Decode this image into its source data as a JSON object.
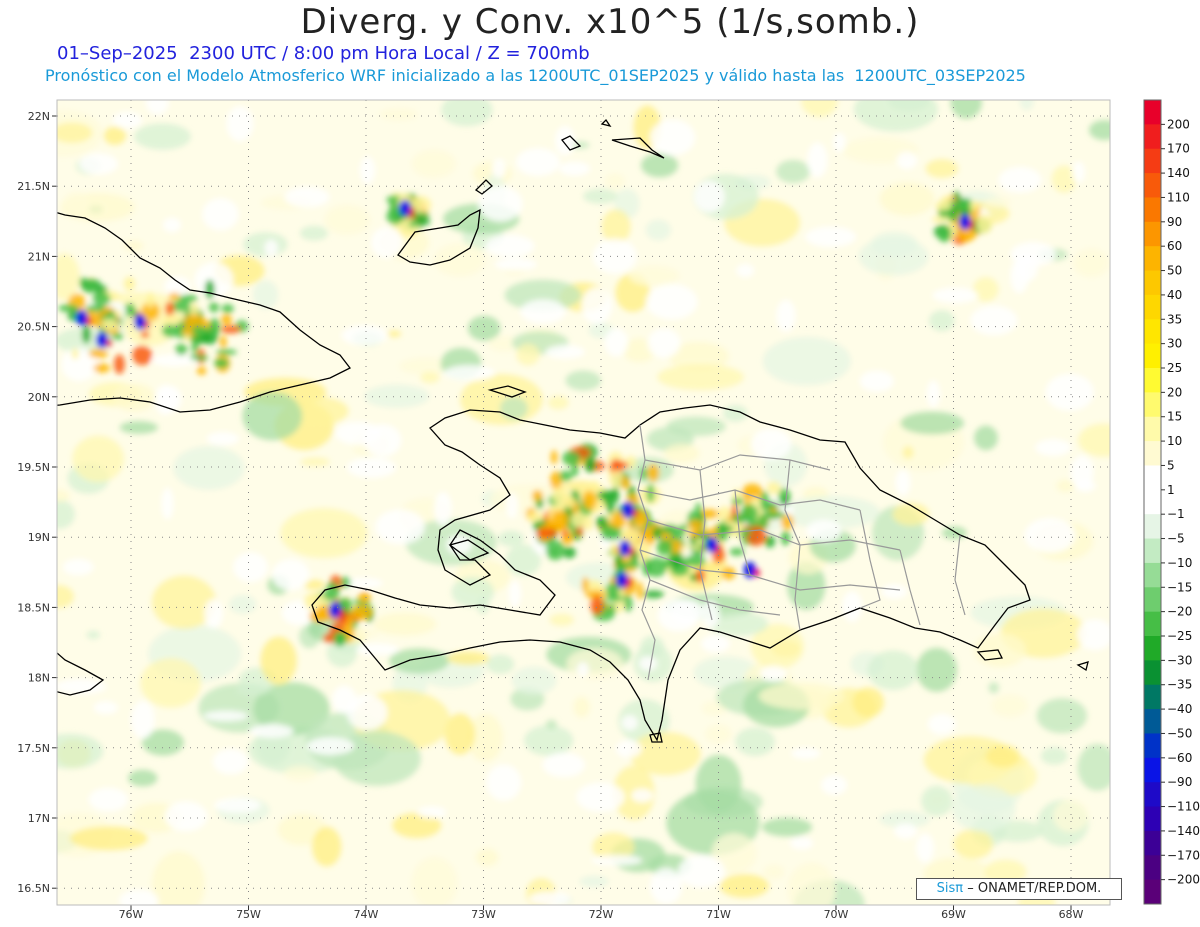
{
  "title": "Diverg. y Conv. x10^5 (1/s,somb.)",
  "subtitle_time": "01–Sep–2025  2300 UTC / 8:00 pm Hora Local / Z = 700mb",
  "subtitle_model": "Pronóstico con el Modelo Atmosferico WRF inicializado a las 1200UTC_01SEP2025 y válido hasta las  1200UTC_03SEP2025",
  "credit": {
    "brand": "Sisπ",
    "rest": "– ONAMET/REP.DOM."
  },
  "lat_labels": [
    "22N",
    "21.5N",
    "21N",
    "20.5N",
    "20N",
    "19.5N",
    "19N",
    "18.5N",
    "18N",
    "17.5N",
    "17N",
    "16.5N"
  ],
  "lon_labels": [
    "76W",
    "75W",
    "74W",
    "73W",
    "72W",
    "71W",
    "70W",
    "69W",
    "68W"
  ],
  "colorbar": {
    "labels": [
      "200",
      "170",
      "140",
      "110",
      "90",
      "60",
      "50",
      "40",
      "35",
      "30",
      "25",
      "20",
      "15",
      "10",
      "5",
      "1",
      "−1",
      "−5",
      "−10",
      "−15",
      "−20",
      "−25",
      "−30",
      "−35",
      "−40",
      "−50",
      "−60",
      "−90",
      "−110",
      "−140",
      "−170",
      "−200"
    ],
    "colors": [
      "#e8002a",
      "#f01e1e",
      "#f53c14",
      "#f85a0a",
      "#fa7800",
      "#fc9600",
      "#fdb400",
      "#fdc800",
      "#fed700",
      "#ffe600",
      "#fff000",
      "#fffa32",
      "#fffa6e",
      "#fffaaa",
      "#fffad2",
      "#ffffff",
      "#ffffff",
      "#e6f5e6",
      "#c3ebc3",
      "#96dc96",
      "#6ecd6e",
      "#46be46",
      "#20aa28",
      "#0a9132",
      "#007864",
      "#005a96",
      "#0032c8",
      "#0a14e6",
      "#1e0ac8",
      "#2d00b4",
      "#3c0096",
      "#4b0082",
      "#5a0078"
    ]
  }
}
